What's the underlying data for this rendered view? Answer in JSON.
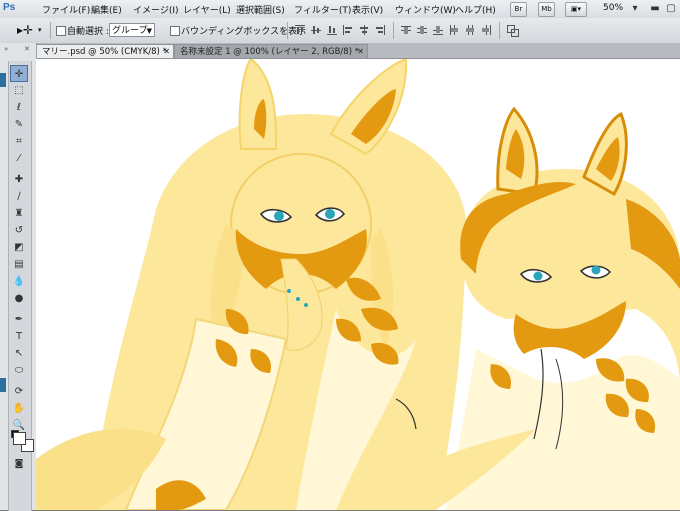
{
  "app": {
    "logo": "Ps"
  },
  "menu": [
    "ファイル(F)",
    "編集(E)",
    "イメージ(I)",
    "レイヤー(L)",
    "選択範囲(S)",
    "フィルター(T)",
    "表示(V)",
    "ウィンドウ(W)",
    "ヘルプ(H)"
  ],
  "appbar": {
    "bridge": "Br",
    "minibridge": "Mb",
    "zoom": "50%"
  },
  "options": {
    "auto_select_label": "自動選択 :",
    "auto_select_value": "グループ",
    "bounding_box_label": "バウンディングボックスを表示"
  },
  "tabs": [
    {
      "label": "マリー.psd @ 50% (CMYK/8) *"
    },
    {
      "label": "名称未設定 1 @ 100% (レイヤー 2, RGB/8) *"
    }
  ],
  "colors": {
    "fur_light": "#fde79a",
    "fur_mid": "#f8d570",
    "accent_orange": "#e39a10",
    "eye_teal": "#2aa6b8"
  }
}
